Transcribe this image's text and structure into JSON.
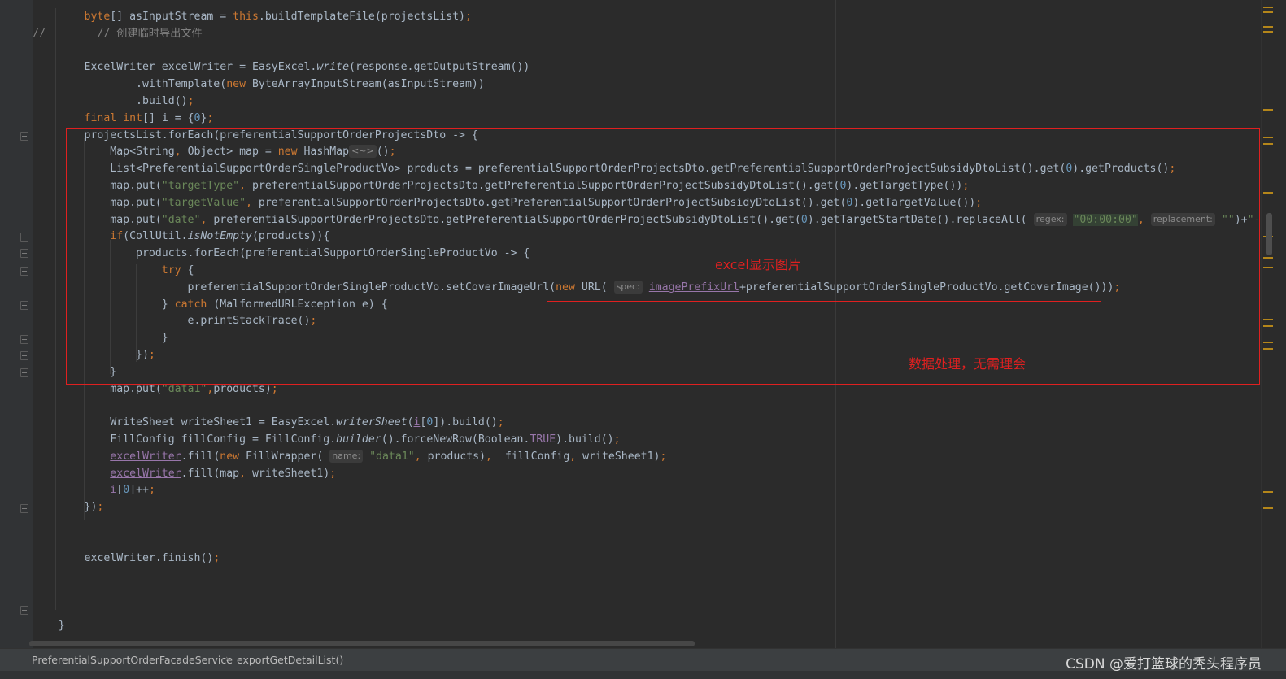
{
  "editor": {
    "lines": [
      [
        [
          "",
          "        "
        ],
        [
          "kw",
          "byte"
        ],
        [
          "",
          "[] asInputStream = "
        ],
        [
          "kw",
          "this"
        ],
        [
          "",
          ".buildTemplateFile(projectsList)"
        ],
        [
          "kw",
          ";"
        ]
      ],
      [
        [
          "cmt",
          "//        // 创建临时导出文件"
        ]
      ],
      [
        [
          "",
          ""
        ]
      ],
      [
        [
          "",
          "        ExcelWriter excelWriter = EasyExcel."
        ],
        [
          "it",
          "write"
        ],
        [
          "",
          "(response.getOutputStream())"
        ]
      ],
      [
        [
          "",
          "                .withTemplate("
        ],
        [
          "kw",
          "new "
        ],
        [
          "",
          "ByteArrayInputStream(asInputStream))"
        ]
      ],
      [
        [
          "",
          "                .build()"
        ],
        [
          "kw",
          ";"
        ]
      ],
      [
        [
          "",
          "        "
        ],
        [
          "kw",
          "final int"
        ],
        [
          "",
          "[] i = {"
        ],
        [
          "num",
          "0"
        ],
        [
          "",
          "}"
        ],
        [
          "kw",
          ";"
        ]
      ],
      [
        [
          "",
          "        projectsList.forEach(preferentialSupportOrderProjectsDto -> {"
        ]
      ],
      [
        [
          "",
          "            Map<String"
        ],
        [
          "kw",
          ", "
        ],
        [
          "",
          "Object> map = "
        ],
        [
          "kw",
          "new "
        ],
        [
          "",
          "HashMap"
        ],
        [
          "hint",
          "<~>"
        ],
        [
          "",
          "()"
        ],
        [
          "kw",
          ";"
        ]
      ],
      [
        [
          "",
          "            List<PreferentialSupportOrderSingleProductVo> products = preferentialSupportOrderProjectsDto.getPreferentialSupportOrderProjectSubsidyDtoList().get("
        ],
        [
          "num",
          "0"
        ],
        [
          "",
          ").getProducts()"
        ],
        [
          "kw",
          ";"
        ]
      ],
      [
        [
          "",
          "            map.put("
        ],
        [
          "str",
          "\"targetType\""
        ],
        [
          "kw",
          ", "
        ],
        [
          "",
          "preferentialSupportOrderProjectsDto.getPreferentialSupportOrderProjectSubsidyDtoList().get("
        ],
        [
          "num",
          "0"
        ],
        [
          "",
          ").getTargetType())"
        ],
        [
          "kw",
          ";"
        ]
      ],
      [
        [
          "",
          "            map.put("
        ],
        [
          "str",
          "\"targetValue\""
        ],
        [
          "kw",
          ", "
        ],
        [
          "",
          "preferentialSupportOrderProjectsDto.getPreferentialSupportOrderProjectSubsidyDtoList().get("
        ],
        [
          "num",
          "0"
        ],
        [
          "",
          ").getTargetValue())"
        ],
        [
          "kw",
          ";"
        ]
      ],
      [
        [
          "",
          "            map.put("
        ],
        [
          "str",
          "\"date\""
        ],
        [
          "kw",
          ", "
        ],
        [
          "",
          "preferentialSupportOrderProjectsDto.getPreferentialSupportOrderProjectSubsidyDtoList().get("
        ],
        [
          "num",
          "0"
        ],
        [
          "",
          ").getTargetStartDate().replaceAll( "
        ],
        [
          "hint",
          "regex:"
        ],
        [
          "",
          " "
        ],
        [
          "strhl",
          "\"00:00:00\""
        ],
        [
          "kw",
          ", "
        ],
        [
          "hint",
          "replacement:"
        ],
        [
          "",
          " "
        ],
        [
          "str",
          "\"\""
        ],
        [
          "",
          ")+"
        ],
        [
          "str",
          "\"-\""
        ],
        [
          "",
          "+ p"
        ]
      ],
      [
        [
          "",
          "            "
        ],
        [
          "kw",
          "if"
        ],
        [
          "",
          "(CollUtil."
        ],
        [
          "it",
          "isNotEmpty"
        ],
        [
          "",
          "(products)){"
        ]
      ],
      [
        [
          "",
          "                products.forEach(preferentialSupportOrderSingleProductVo -> {"
        ]
      ],
      [
        [
          "",
          "                    "
        ],
        [
          "kw",
          "try "
        ],
        [
          "",
          "{"
        ]
      ],
      [
        [
          "",
          "                        preferentialSupportOrderSingleProductVo.setCoverImageUrl("
        ],
        [
          "kw",
          "new "
        ],
        [
          "",
          "URL( "
        ],
        [
          "hint",
          "spec:"
        ],
        [
          "",
          " "
        ],
        [
          "ul",
          "imagePrefixUrl"
        ],
        [
          "",
          "+preferentialSupportOrderSingleProductVo.getCoverImage()))"
        ],
        [
          "kw",
          ";"
        ]
      ],
      [
        [
          "",
          "                    } "
        ],
        [
          "kw",
          "catch "
        ],
        [
          "",
          "(MalformedURLException e) {"
        ]
      ],
      [
        [
          "",
          "                        e.printStackTrace()"
        ],
        [
          "kw",
          ";"
        ]
      ],
      [
        [
          "",
          "                    }"
        ]
      ],
      [
        [
          "",
          "                })"
        ],
        [
          "kw",
          ";"
        ]
      ],
      [
        [
          "",
          "            }"
        ]
      ],
      [
        [
          "",
          "            map.put("
        ],
        [
          "str",
          "\"data1\""
        ],
        [
          "kw",
          ","
        ],
        [
          "",
          "products)"
        ],
        [
          "kw",
          ";"
        ]
      ],
      [
        [
          "",
          ""
        ]
      ],
      [
        [
          "",
          "            WriteSheet writeSheet1 = EasyExcel."
        ],
        [
          "it",
          "writerSheet"
        ],
        [
          "",
          "("
        ],
        [
          "ul",
          "i"
        ],
        [
          "",
          "["
        ],
        [
          "num",
          "0"
        ],
        [
          "",
          "]).build()"
        ],
        [
          "kw",
          ";"
        ]
      ],
      [
        [
          "",
          "            FillConfig fillConfig = FillConfig."
        ],
        [
          "it",
          "builder"
        ],
        [
          "",
          "().forceNewRow(Boolean."
        ],
        [
          "field",
          "TRUE"
        ],
        [
          "",
          ").build()"
        ],
        [
          "kw",
          ";"
        ]
      ],
      [
        [
          "",
          "            "
        ],
        [
          "ul",
          "excelWriter"
        ],
        [
          "",
          ".fill("
        ],
        [
          "kw",
          "new "
        ],
        [
          "",
          "FillWrapper( "
        ],
        [
          "hint",
          "name:"
        ],
        [
          "",
          " "
        ],
        [
          "str",
          "\"data1\""
        ],
        [
          "kw",
          ", "
        ],
        [
          "",
          "products)"
        ],
        [
          "kw",
          ",  "
        ],
        [
          "",
          "fillConfig"
        ],
        [
          "kw",
          ", "
        ],
        [
          "",
          "writeSheet1)"
        ],
        [
          "kw",
          ";"
        ]
      ],
      [
        [
          "",
          "            "
        ],
        [
          "ul",
          "excelWriter"
        ],
        [
          "",
          ".fill(map"
        ],
        [
          "kw",
          ", "
        ],
        [
          "",
          "writeSheet1)"
        ],
        [
          "kw",
          ";"
        ]
      ],
      [
        [
          "",
          "            "
        ],
        [
          "ul",
          "i"
        ],
        [
          "",
          "["
        ],
        [
          "num",
          "0"
        ],
        [
          "",
          "]++"
        ],
        [
          "kw",
          ";"
        ]
      ],
      [
        [
          "",
          "        })"
        ],
        [
          "kw",
          ";"
        ]
      ],
      [
        [
          "",
          ""
        ]
      ],
      [
        [
          "",
          ""
        ]
      ],
      [
        [
          "",
          "        excelWriter.finish()"
        ],
        [
          "kw",
          ";"
        ]
      ],
      [
        [
          "",
          ""
        ]
      ],
      [
        [
          "",
          ""
        ]
      ],
      [
        [
          "",
          ""
        ]
      ],
      [
        [
          "",
          "    }"
        ]
      ],
      [
        [
          "",
          ""
        ]
      ],
      [
        [
          "cmt",
          "    /**"
        ]
      ]
    ]
  },
  "annotations": {
    "excel_image": "excel显示图片",
    "data_processing": "数据处理，无需理会"
  },
  "breadcrumb": {
    "class_name": "PreferentialSupportOrderFacadeService",
    "method_name": "exportGetDetailList()"
  },
  "watermark": "CSDN @爱打篮球的秃头程序员",
  "colors": {
    "background": "#2b2b2b",
    "keyword": "#cc7832",
    "string": "#6a8759",
    "number": "#6897bb",
    "annotation_red": "#e02020"
  },
  "icons": [
    "fold-marker-icon",
    "breadcrumb-separator-icon"
  ]
}
